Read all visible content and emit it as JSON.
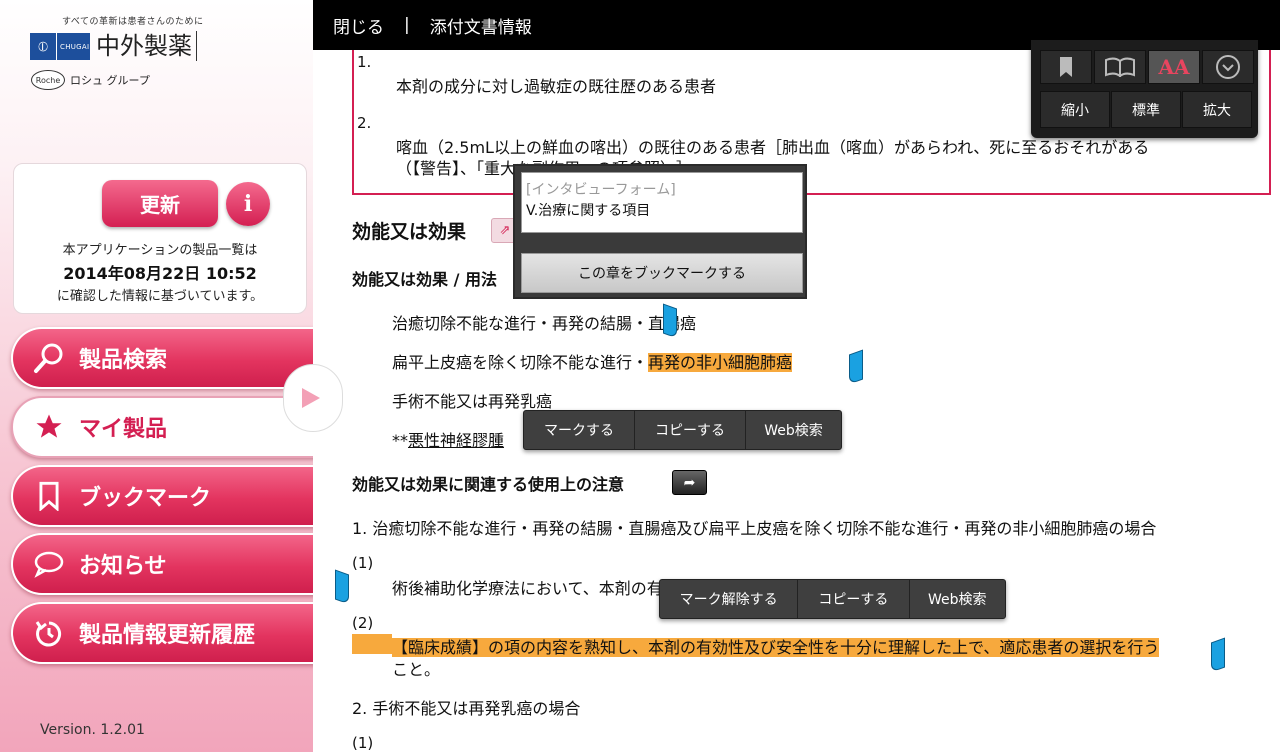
{
  "sidebar": {
    "tagline": "すべての革新は患者さんのために",
    "logo_company_en": "CHUGAI",
    "logo_company_ja": "中外製薬",
    "roche_mark": "Roche",
    "group_label": "ロシュ グループ",
    "update_button": "更新",
    "info_button": "i",
    "update_line1": "本アプリケーションの製品一覧は",
    "update_datetime": "2014年08月22日 10:52",
    "update_line3": "に確認した情報に基づいています。",
    "nav": [
      {
        "label": "製品検索",
        "icon": "search-icon"
      },
      {
        "label": "マイ製品",
        "icon": "star-icon"
      },
      {
        "label": "ブックマーク",
        "icon": "bookmark-icon"
      },
      {
        "label": "お知らせ",
        "icon": "speech-bubble-icon"
      },
      {
        "label": "製品情報更新履歴",
        "icon": "history-icon"
      }
    ],
    "version": "Version. 1.2.01"
  },
  "topbar": {
    "close": "閉じる",
    "separator": "|",
    "title": "添付文書情報"
  },
  "font_panel": {
    "icons": [
      "bookmark-icon",
      "book-icon",
      "font-size-icon",
      "dropdown-icon"
    ],
    "font_icon_text": "AA",
    "sizes": [
      "縮小",
      "標準",
      "拡大"
    ]
  },
  "warning_box": {
    "item1_num": "1.",
    "item1_text": "本剤の成分に対し過敏症の既往歴のある患者",
    "item2_num": "2.",
    "item2_text_line1": "喀血（2.5mL以上の鮮血の喀出）の既往のある患者［肺出血（喀血）があらわれ、死に至るおそれがある",
    "item2_text_line2": "（【警告】、「重大な副作用」の項参照）。］"
  },
  "content": {
    "section_title": "効能又は効果",
    "subsection_title": "効能又は効果 / 用法",
    "indications": [
      "治癒切除不能な進行・再発の結腸・直腸癌",
      "扁平上皮癌を除く切除不能な進行・",
      "再発の非小細胞肺癌",
      "手術不能又は再発乳癌",
      "**",
      "悪性神経膠腫"
    ],
    "precautions_title": "効能又は効果に関連する使用上の注意",
    "precaution1": "1. 治癒切除不能な進行・再発の結腸・直腸癌及び扁平上皮癌を除く切除不能な進行・再発の非小細胞肺癌の場合",
    "p1_sub1_num": "(1)",
    "p1_sub1_text": "術後補助化学療法において、本剤の有効性及び安全性は確立していない。",
    "p1_sub2_num": "(2)",
    "p1_sub2_text_line1": "【臨床成績】の項の内容を熟知し、本剤の有効性及び安全性を十分に理解した上で、適応患者の選択を行う",
    "p1_sub2_text_line2": "こと。",
    "precaution2": "2. 手術不能又は再発乳癌の場合",
    "p2_sub1_num": "(1)"
  },
  "bookmark_popup": {
    "placeholder": "[インタビューフォーム]",
    "value": "V.治療に関する項目",
    "button": "この章をブックマークする"
  },
  "action_bar_1": [
    "マークする",
    "コピーする",
    "Web検索"
  ],
  "action_bar_2": [
    "マーク解除する",
    "コピーする",
    "Web検索"
  ],
  "colors": {
    "accent": "#d41f52",
    "highlight": "#f7a93d",
    "handle": "#1aa1e1",
    "topbar": "#000000"
  }
}
